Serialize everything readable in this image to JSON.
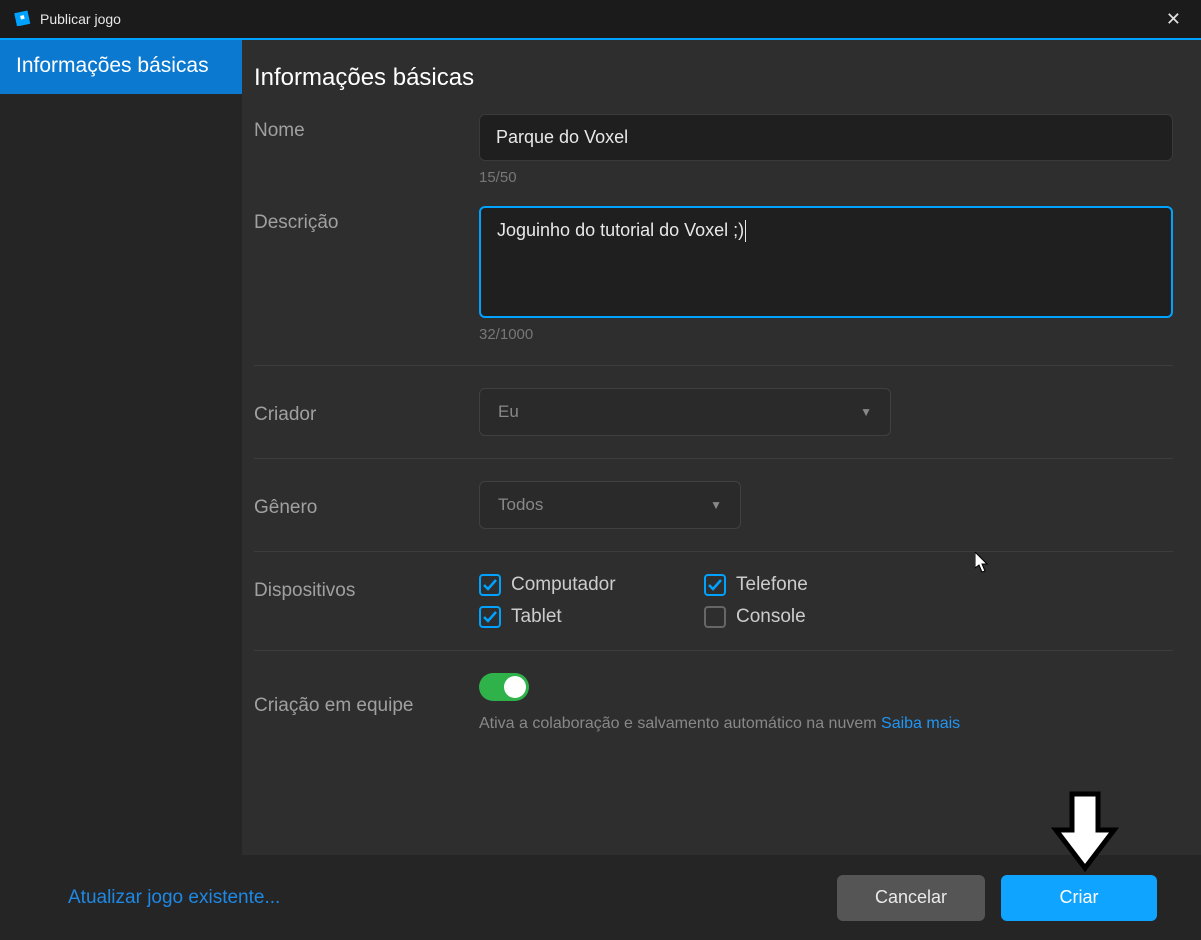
{
  "title_bar": {
    "title": "Publicar jogo"
  },
  "sidebar": {
    "tabs": [
      {
        "label": "Informações básicas"
      }
    ]
  },
  "page": {
    "title": "Informações básicas"
  },
  "fields": {
    "name": {
      "label": "Nome",
      "value": "Parque do Voxel",
      "counter": "15/50"
    },
    "description": {
      "label": "Descrição",
      "value": "Joguinho do tutorial do Voxel ;)",
      "counter": "32/1000"
    },
    "creator": {
      "label": "Criador",
      "selected": "Eu"
    },
    "genre": {
      "label": "Gênero",
      "selected": "Todos"
    },
    "devices": {
      "label": "Dispositivos",
      "options": {
        "computer": {
          "label": "Computador",
          "checked": true
        },
        "phone": {
          "label": "Telefone",
          "checked": true
        },
        "tablet": {
          "label": "Tablet",
          "checked": true
        },
        "console": {
          "label": "Console",
          "checked": false
        }
      }
    },
    "team_create": {
      "label": "Criação em equipe",
      "enabled": true,
      "help_text": "Ativa a colaboração e salvamento automático na nuvem",
      "help_link": "Saiba mais"
    }
  },
  "footer": {
    "update_existing": "Atualizar jogo existente...",
    "cancel": "Cancelar",
    "create": "Criar"
  }
}
